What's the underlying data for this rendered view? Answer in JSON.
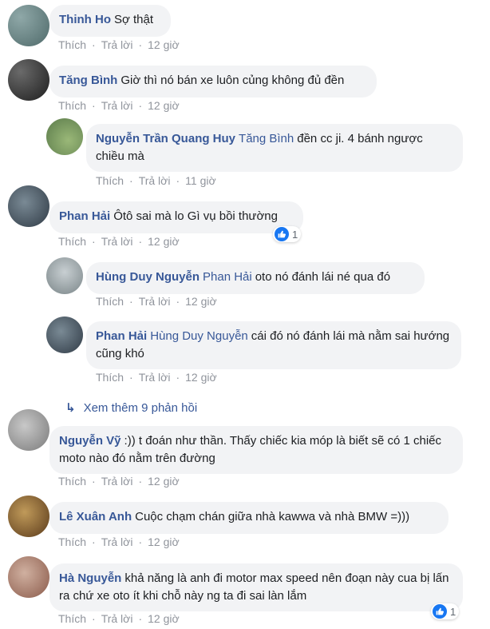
{
  "actions": {
    "like": "Thích",
    "reply": "Trả lời",
    "separator": "·"
  },
  "comments": [
    {
      "author": "Thinh Ho",
      "text": "Sợ thật",
      "time": "12 giờ",
      "avatar_color": "#6f8a8a"
    },
    {
      "author": "Tăng Bình",
      "text": "Giờ thì nó bán xe luôn củng không đủ đền",
      "time": "12 giờ",
      "avatar_color": "#3a3a3a"
    },
    {
      "author": "Nguyễn Trần Quang Huy",
      "tag": "Tăng Bình",
      "text": "đền cc ji. 4 bánh ngược chiều mà",
      "time": "11 giờ",
      "avatar_color": "#7c9a5a"
    },
    {
      "author": "Phan Hải",
      "text": "Ôtô sai mà lo Gì vụ bồi thường",
      "time": "12 giờ",
      "reactions": "1",
      "avatar_color": "#4a5560"
    },
    {
      "author": "Hùng Duy Nguyễn",
      "tag": "Phan Hải",
      "text": "oto nó đánh lái né qua đó",
      "time": "12 giờ",
      "avatar_color": "#9aa5a8"
    },
    {
      "author": "Phan Hải",
      "tag": "Hùng Duy Nguyễn",
      "text": "cái đó nó đánh lái mà nằm sai hướng cũng khó",
      "time": "12 giờ",
      "avatar_color": "#4a5560"
    },
    {
      "author": "Nguyễn Vỹ",
      "text": ":)) t đoán như thần. Thấy chiếc kia móp là biết sẽ có 1 chiếc moto nào đó nằm trên đường",
      "time": "12 giờ",
      "avatar_color": "#9a9a9a"
    },
    {
      "author": "Lê Xuân Anh",
      "text": "Cuộc chạm chán giữa nhà kawwa và nhà BMW =)))",
      "time": "12 giờ",
      "avatar_color": "#8a6a3a"
    },
    {
      "author": "Hà Nguyễn",
      "text": "khả năng là anh đi motor max speed nên đoạn này cua bị lấn ra chứ xe oto ít khi chỗ này ng ta đi sai làn lắm",
      "time": "12 giờ",
      "reactions": "1",
      "avatar_color": "#a07a6a"
    }
  ],
  "more_replies": "Xem thêm 9 phản hồi",
  "colors": {
    "link": "#385898",
    "bubble": "#f2f3f5",
    "meta": "#90949c",
    "like": "#1877f2"
  }
}
